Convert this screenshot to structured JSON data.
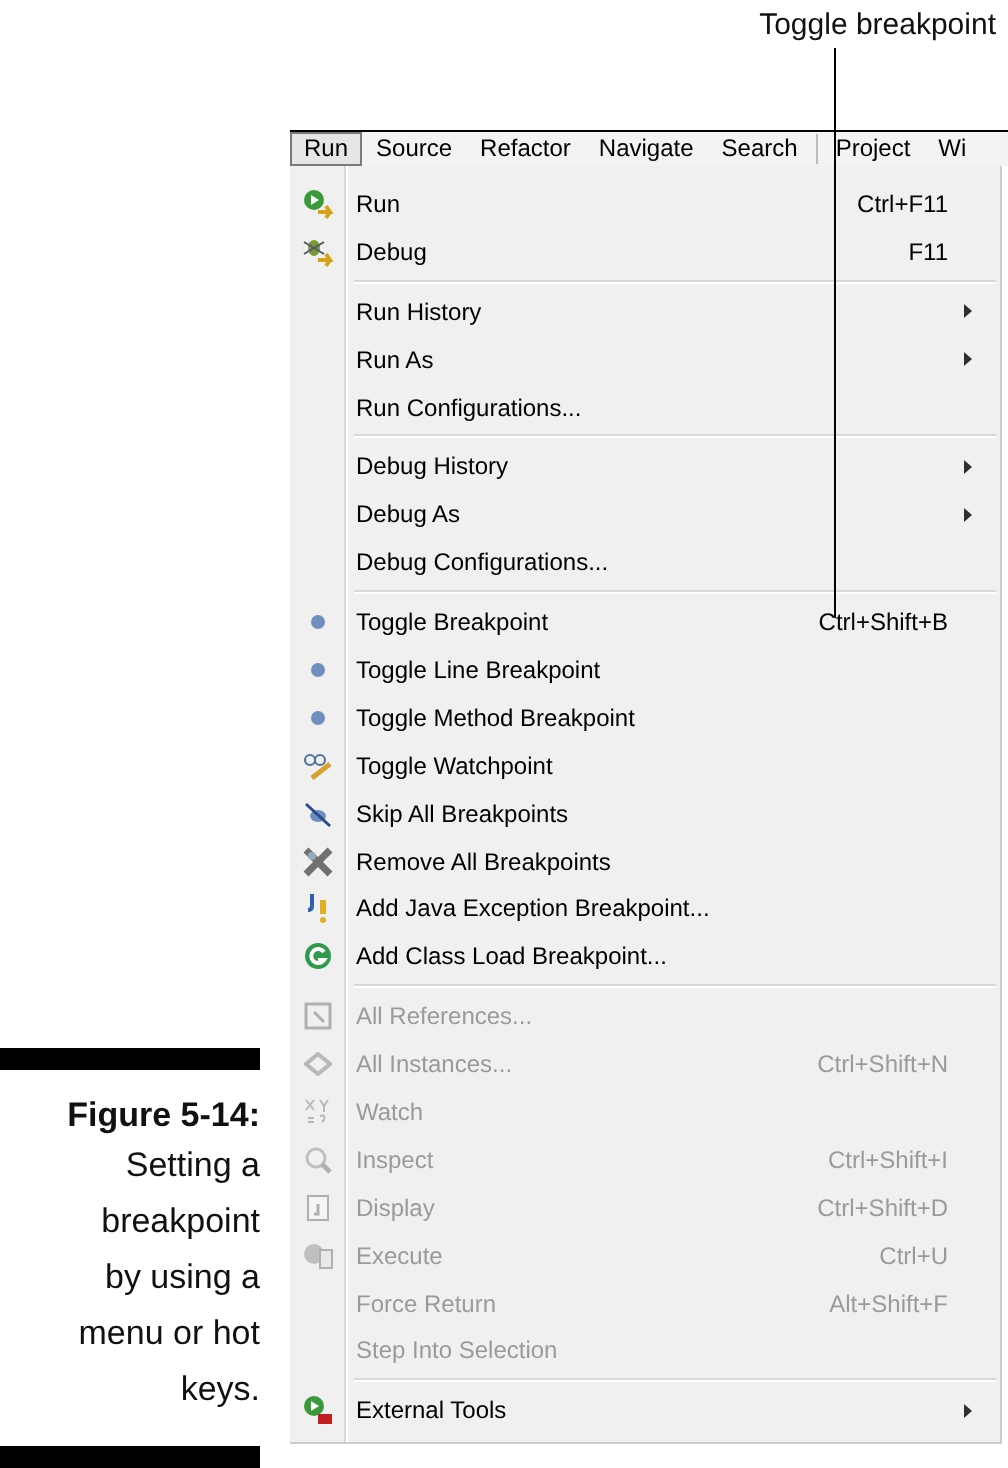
{
  "callout": {
    "label": "Toggle breakpoint"
  },
  "menu_bar": [
    {
      "label": "Run",
      "selected": true
    },
    {
      "label": "Source",
      "selected": false
    },
    {
      "label": "Refactor",
      "selected": false
    },
    {
      "label": "Navigate",
      "selected": false
    },
    {
      "label": "Search",
      "selected": false
    },
    {
      "label": "Project",
      "selected": false
    },
    {
      "label": "Wi",
      "selected": false
    }
  ],
  "menu_groups": [
    [
      {
        "label": "Run",
        "shortcut": "Ctrl+F11",
        "submenu": false,
        "disabled": false
      },
      {
        "label": "Debug",
        "shortcut": "F11",
        "submenu": false,
        "disabled": false
      }
    ],
    [
      {
        "label": "Run History",
        "submenu": true,
        "disabled": false
      },
      {
        "label": "Run As",
        "submenu": true,
        "disabled": false
      },
      {
        "label": "Run Configurations...",
        "submenu": false,
        "disabled": false
      }
    ],
    [
      {
        "label": "Debug History",
        "submenu": true,
        "disabled": false
      },
      {
        "label": "Debug As",
        "submenu": true,
        "disabled": false
      },
      {
        "label": "Debug Configurations...",
        "submenu": false,
        "disabled": false
      }
    ],
    [
      {
        "label": "Toggle Breakpoint",
        "shortcut": "Ctrl+Shift+B",
        "submenu": false,
        "disabled": false
      },
      {
        "label": "Toggle Line Breakpoint",
        "submenu": false,
        "disabled": false
      },
      {
        "label": "Toggle Method Breakpoint",
        "submenu": false,
        "disabled": false
      },
      {
        "label": "Toggle Watchpoint",
        "submenu": false,
        "disabled": false
      },
      {
        "label": "Skip All Breakpoints",
        "submenu": false,
        "disabled": false
      },
      {
        "label": "Remove All Breakpoints",
        "submenu": false,
        "disabled": false
      },
      {
        "label": "Add Java Exception Breakpoint...",
        "submenu": false,
        "disabled": false
      },
      {
        "label": "Add Class Load Breakpoint...",
        "submenu": false,
        "disabled": false
      }
    ],
    [
      {
        "label": "All References...",
        "submenu": false,
        "disabled": true
      },
      {
        "label": "All Instances...",
        "shortcut": "Ctrl+Shift+N",
        "submenu": false,
        "disabled": true
      },
      {
        "label": "Watch",
        "submenu": false,
        "disabled": true
      },
      {
        "label": "Inspect",
        "shortcut": "Ctrl+Shift+I",
        "submenu": false,
        "disabled": true
      },
      {
        "label": "Display",
        "shortcut": "Ctrl+Shift+D",
        "submenu": false,
        "disabled": true
      },
      {
        "label": "Execute",
        "shortcut": "Ctrl+U",
        "submenu": false,
        "disabled": true
      },
      {
        "label": "Force Return",
        "shortcut": "Alt+Shift+F",
        "submenu": false,
        "disabled": true
      },
      {
        "label": "Step Into Selection",
        "submenu": false,
        "disabled": true
      }
    ],
    [
      {
        "label": "External Tools",
        "submenu": true,
        "disabled": false
      }
    ]
  ],
  "caption": {
    "title": "Figure 5-14:",
    "text": "Setting a\nbreakpoint\nby using a\nmenu or hot\nkeys."
  }
}
